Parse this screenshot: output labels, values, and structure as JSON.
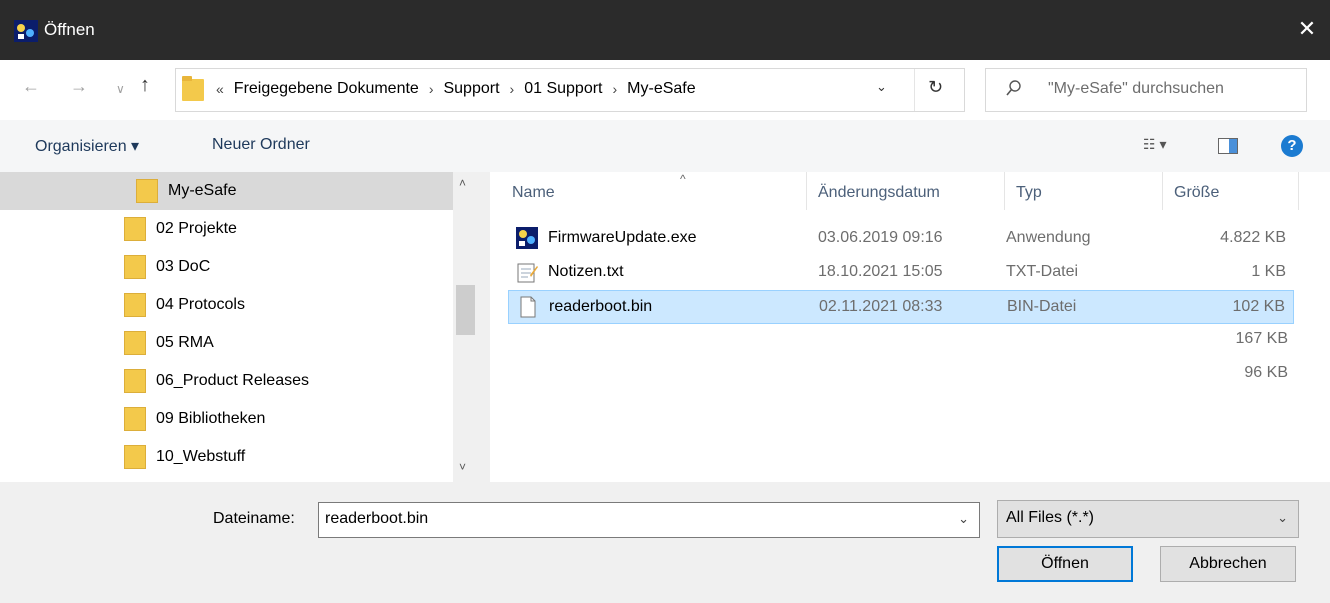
{
  "window": {
    "title": "Öffnen",
    "close_glyph": "✕"
  },
  "nav": {
    "back_glyph": "←",
    "forward_glyph": "→",
    "recent_glyph": "∨",
    "up_glyph": "↑",
    "breadcrumb_prefix": "«",
    "breadcrumbs": [
      "Freigegebene Dokumente",
      "Support",
      "01 Support",
      "My-eSafe"
    ],
    "separator": "›",
    "dropdown_glyph": "⌄",
    "refresh_glyph": "↻"
  },
  "search": {
    "placeholder": "\"My-eSafe\" durchsuchen",
    "icon": "search-icon"
  },
  "toolbar": {
    "organize_label": "Organisieren ▾",
    "new_folder_label": "Neuer Ordner",
    "views_label": "☷ ▾",
    "help_label": "?"
  },
  "tree": {
    "items": [
      {
        "label": "My-eSafe",
        "selected": true
      },
      {
        "label": "02 Projekte"
      },
      {
        "label": "03 DoC"
      },
      {
        "label": "04 Protocols"
      },
      {
        "label": "05 RMA"
      },
      {
        "label": "06_Product Releases"
      },
      {
        "label": "09 Bibliotheken"
      },
      {
        "label": "10_Webstuff"
      }
    ],
    "scroll_up": "˄",
    "scroll_down": "˅"
  },
  "files": {
    "sort_arrow": "^",
    "columns": {
      "name": "Name",
      "date": "Änderungsdatum",
      "type": "Typ",
      "size": "Größe"
    },
    "rows": [
      {
        "name": "FirmwareUpdate.exe",
        "date": "03.06.2019 09:16",
        "type": "Anwendung",
        "size": "4.822 KB",
        "icon": "exe-icon"
      },
      {
        "name": "Notizen.txt",
        "date": "18.10.2021 15:05",
        "type": "TXT-Datei",
        "size": "1 KB",
        "icon": "notepad-icon"
      },
      {
        "name": "readerboot.bin",
        "date": "02.11.2021 08:33",
        "type": "BIN-Datei",
        "size": "102 KB",
        "icon": "blank-file-icon",
        "selected": true
      }
    ],
    "extra_sizes": [
      "167 KB",
      "96 KB"
    ]
  },
  "bottom": {
    "filename_label": "Dateiname:",
    "filename_value": "readerboot.bin",
    "filter_value": "All Files (*.*)",
    "open_label": "Öffnen",
    "cancel_label": "Abbrechen",
    "dropdown_glyph": "⌄"
  },
  "colors": {
    "accent": "#0078d7",
    "selection": "#cce8ff",
    "folder": "#f3c94b"
  }
}
